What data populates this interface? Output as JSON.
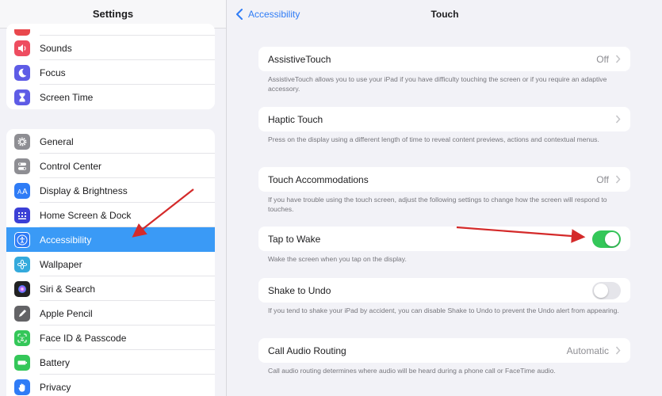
{
  "sidebar": {
    "title": "Settings",
    "group1": [
      {
        "label": "Sounds",
        "icon": "speaker-icon",
        "color": "#ee4d60"
      },
      {
        "label": "Focus",
        "icon": "moon-icon",
        "color": "#5e5ce6"
      },
      {
        "label": "Screen Time",
        "icon": "hourglass-icon",
        "color": "#5e5ce6"
      }
    ],
    "group2": [
      {
        "label": "General",
        "icon": "gear-icon",
        "color": "#8e8e93"
      },
      {
        "label": "Control Center",
        "icon": "toggles-icon",
        "color": "#8e8e93"
      },
      {
        "label": "Display & Brightness",
        "icon": "text-size-icon",
        "color": "#2f7cf6"
      },
      {
        "label": "Home Screen & Dock",
        "icon": "grid-icon",
        "color": "#3b3fd6"
      },
      {
        "label": "Accessibility",
        "icon": "accessibility-icon",
        "color": "#2f7cf6"
      },
      {
        "label": "Wallpaper",
        "icon": "flower-icon",
        "color": "#34aadc"
      },
      {
        "label": "Siri & Search",
        "icon": "siri-icon",
        "color": "#222222"
      },
      {
        "label": "Apple Pencil",
        "icon": "pencil-icon",
        "color": "#636366"
      },
      {
        "label": "Face ID & Passcode",
        "icon": "face-id-icon",
        "color": "#34c759"
      },
      {
        "label": "Battery",
        "icon": "battery-icon",
        "color": "#34c759"
      },
      {
        "label": "Privacy",
        "icon": "hand-icon",
        "color": "#2f7cf6"
      }
    ],
    "selected": "Accessibility"
  },
  "header": {
    "back_label": "Accessibility",
    "title": "Touch"
  },
  "settings": {
    "assistive_touch": {
      "label": "AssistiveTouch",
      "value": "Off",
      "desc": "AssistiveTouch allows you to use your iPad if you have difficulty touching the screen or if you require an adaptive accessory."
    },
    "haptic_touch": {
      "label": "Haptic Touch",
      "desc": "Press on the display using a different length of time to reveal content previews, actions and contextual menus."
    },
    "touch_accommodations": {
      "label": "Touch Accommodations",
      "value": "Off",
      "desc": "If you have trouble using the touch screen, adjust the following settings to change how the screen will respond to touches."
    },
    "tap_to_wake": {
      "label": "Tap to Wake",
      "enabled": true,
      "desc": "Wake the screen when you tap on the display."
    },
    "shake_to_undo": {
      "label": "Shake to Undo",
      "enabled": false,
      "desc": "If you tend to shake your iPad by accident, you can disable Shake to Undo to prevent the Undo alert from appearing."
    },
    "call_audio_routing": {
      "label": "Call Audio Routing",
      "value": "Automatic",
      "desc": "Call audio routing determines where audio will be heard during a phone call or FaceTime audio."
    }
  },
  "colors": {
    "accent": "#2f7cf6",
    "selection": "#3a9af6",
    "toggle_on": "#34c759",
    "annotation_arrow": "#d42a2a"
  }
}
